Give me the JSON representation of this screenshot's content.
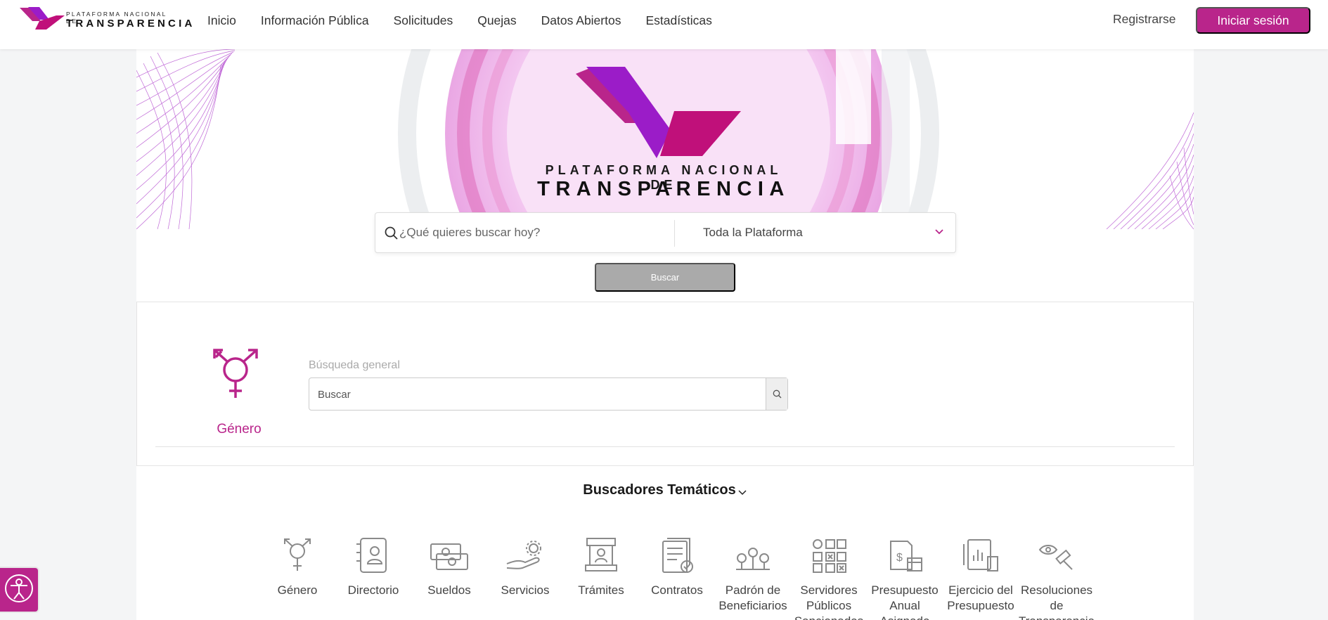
{
  "header": {
    "logo_line1": "PLATAFORMA NACIONAL DE",
    "logo_line2": "TRANSPARENCIA",
    "nav": [
      "Inicio",
      "Información Pública",
      "Solicitudes",
      "Quejas",
      "Datos Abiertos",
      "Estadísticas"
    ],
    "register_label": "Registrarse",
    "login_label": "Iniciar sesión"
  },
  "hero": {
    "title_line1": "PLATAFORMA NACIONAL DE",
    "title_line2": "TRANSPARENCIA"
  },
  "search": {
    "placeholder": "¿Qué quieres buscar hoy?",
    "scope": "Toda la Plataforma",
    "button_label": "Buscar"
  },
  "genero_panel": {
    "icon": "gender-icon",
    "label": "Género",
    "search_label": "Búsqueda general",
    "search_placeholder": "Buscar"
  },
  "thematic": {
    "title": "Buscadores Temáticos",
    "items": [
      {
        "icon": "gender-icon",
        "line1": "Género",
        "line2": "",
        "line3": ""
      },
      {
        "icon": "directory-icon",
        "line1": "Directorio",
        "line2": "",
        "line3": ""
      },
      {
        "icon": "salary-icon",
        "line1": "Sueldos",
        "line2": "",
        "line3": ""
      },
      {
        "icon": "services-icon",
        "line1": "Servicios",
        "line2": "",
        "line3": ""
      },
      {
        "icon": "procedures-icon",
        "line1": "Trámites",
        "line2": "",
        "line3": ""
      },
      {
        "icon": "contracts-icon",
        "line1": "Contratos",
        "line2": "",
        "line3": ""
      },
      {
        "icon": "beneficiaries-icon",
        "line1": "Padrón de",
        "line2": "Beneficiarios",
        "line3": ""
      },
      {
        "icon": "public-servants-icon",
        "line1": "Servidores",
        "line2": "Públicos",
        "line3": "Sancionados"
      },
      {
        "icon": "budget-icon",
        "line1": "Presupuesto",
        "line2": "Anual",
        "line3": "Asignado"
      },
      {
        "icon": "budget-exercise-icon",
        "line1": "Ejercicio del",
        "line2": "Presupuesto",
        "line3": ""
      },
      {
        "icon": "resolutions-icon",
        "line1": "Resoluciones",
        "line2": "de",
        "line3": "Transparencia"
      }
    ]
  },
  "colors": {
    "brand": "#b9258b",
    "brand_purple": "#9b1cc8",
    "icon_gray": "#8a8a8a"
  }
}
